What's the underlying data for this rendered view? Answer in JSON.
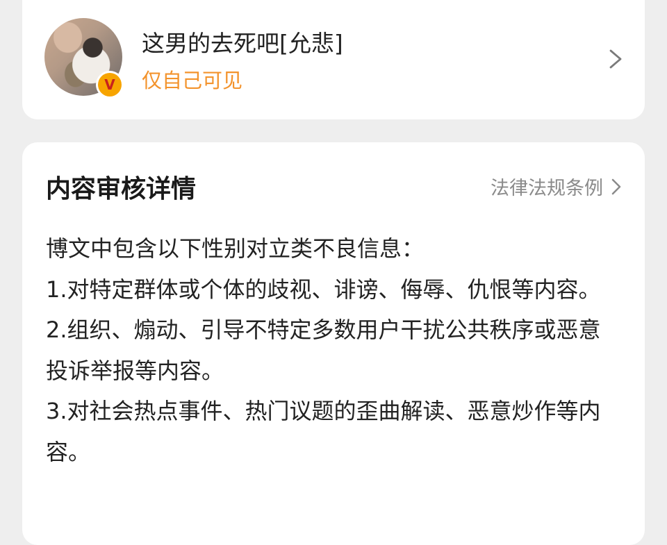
{
  "post": {
    "title": "这男的去死吧[允悲]",
    "visibility": "仅自己可见",
    "badge_letter": "V"
  },
  "review": {
    "title": "内容审核详情",
    "law_link": "法律法规条例",
    "intro": "博文中包含以下性别对立类不良信息：",
    "items": [
      "1.对特定群体或个体的歧视、诽谤、侮辱、仇恨等内容。",
      "2.组织、煽动、引导不特定多数用户干扰公共秩序或恶意投诉举报等内容。",
      "3.对社会热点事件、热门议题的歪曲解读、恶意炒作等内容。"
    ]
  },
  "colors": {
    "accent_orange": "#f3932c",
    "badge_yellow": "#f7a400",
    "muted_gray": "#8a8a8a"
  }
}
